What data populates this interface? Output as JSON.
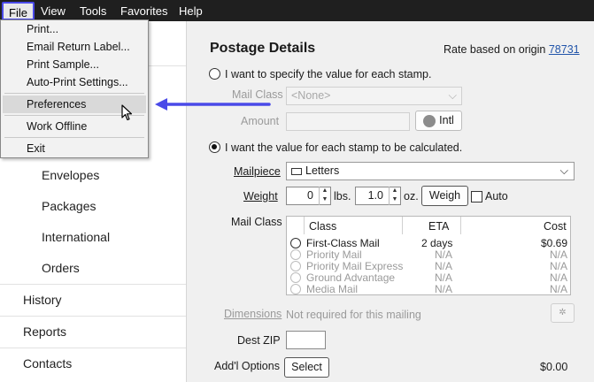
{
  "menubar": {
    "items": [
      "File",
      "View",
      "Tools",
      "Favorites",
      "Help"
    ]
  },
  "file_menu": {
    "items": [
      "Print...",
      "Email Return Label...",
      "Print Sample...",
      "Auto-Print Settings...",
      "Preferences",
      "Work Offline",
      "Exit"
    ],
    "highlighted": "Preferences"
  },
  "sidebar": {
    "subitems": [
      "Envelopes",
      "Packages",
      "International",
      "Orders"
    ],
    "items": [
      "History",
      "Reports",
      "Contacts"
    ]
  },
  "postage": {
    "title": "Postage Details",
    "origin_prefix": "Rate based on origin",
    "origin_zip": "78731",
    "radio_specify": "I want to specify the value for each stamp.",
    "mail_class_label": "Mail Class",
    "mail_class_value": "<None>",
    "amount_label": "Amount",
    "intl_label": "Intl",
    "radio_calculated": "I want the value for each stamp to be calculated.",
    "mailpiece_label": "Mailpiece",
    "mailpiece_value": "Letters",
    "weight_label": "Weight",
    "weight_lbs": "0",
    "lbs_unit": "lbs.",
    "weight_oz": "1.0",
    "oz_unit": "oz.",
    "weigh_button": "Weigh",
    "auto_label": "Auto",
    "mail_class2_label": "Mail Class",
    "table": {
      "headers": [
        "Class",
        "ETA",
        "Cost"
      ],
      "rows": [
        {
          "class": "First-Class Mail",
          "eta": "2 days",
          "cost": "$0.69"
        },
        {
          "class": "Priority Mail",
          "eta": "N/A",
          "cost": "N/A"
        },
        {
          "class": "Priority Mail Express",
          "eta": "N/A",
          "cost": "N/A"
        },
        {
          "class": "Ground Advantage",
          "eta": "N/A",
          "cost": "N/A"
        },
        {
          "class": "Media Mail",
          "eta": "N/A",
          "cost": "N/A"
        }
      ]
    },
    "dimensions_label": "Dimensions",
    "dimensions_note": "Not required for this mailing",
    "dest_zip_label": "Dest ZIP",
    "addl_options_label": "Add'l Options",
    "select_button": "Select",
    "addl_cost": "$0.00"
  },
  "colors": {
    "accent": "#4a4ae8",
    "link": "#2255aa",
    "menubar": "#1f1f1f"
  }
}
